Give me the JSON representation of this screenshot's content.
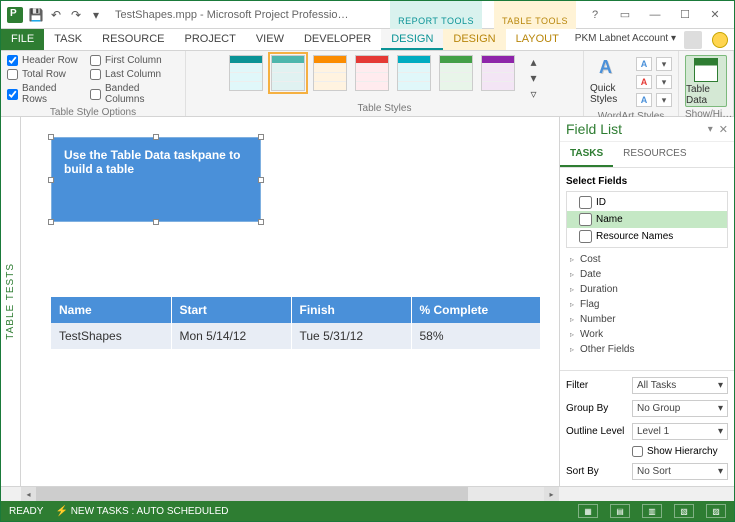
{
  "titlebar": {
    "title": "TestShapes.mpp - Microsoft Project Professio…",
    "context_groups": [
      "REPORT TOOLS",
      "TABLE TOOLS"
    ],
    "account": "PKM Labnet Account"
  },
  "ribbon_tabs": {
    "file": "FILE",
    "items": [
      "TASK",
      "RESOURCE",
      "PROJECT",
      "VIEW",
      "DEVELOPER"
    ],
    "ctx": [
      "DESIGN",
      "DESIGN",
      "LAYOUT"
    ]
  },
  "ribbon": {
    "style_options": {
      "header_row": "Header Row",
      "total_row": "Total Row",
      "banded_rows": "Banded Rows",
      "first_column": "First Column",
      "last_column": "Last Column",
      "banded_columns": "Banded Columns",
      "label": "Table Style Options"
    },
    "table_styles_label": "Table Styles",
    "wordart_label": "WordArt Styles",
    "quick_styles": "Quick Styles",
    "show_hide": {
      "table_data": "Table Data",
      "label": "Show/Hi…"
    }
  },
  "sidebar_vertical": "TABLE TESTS",
  "callout_text": "Use the Table Data taskpane to build a table",
  "table": {
    "headers": [
      "Name",
      "Start",
      "Finish",
      "% Complete"
    ],
    "rows": [
      [
        "TestShapes",
        "Mon 5/14/12",
        "Tue 5/31/12",
        "58%"
      ]
    ]
  },
  "pane": {
    "title": "Field List",
    "tabs": [
      "TASKS",
      "RESOURCES"
    ],
    "select_fields_label": "Select Fields",
    "check_fields": [
      "ID",
      "Name",
      "Resource Names"
    ],
    "tree_fields": [
      "Cost",
      "Date",
      "Duration",
      "Flag",
      "Number",
      "Work",
      "Other Fields"
    ],
    "footer": {
      "filter_label": "Filter",
      "filter_value": "All Tasks",
      "group_label": "Group By",
      "group_value": "No Group",
      "outline_label": "Outline Level",
      "outline_value": "Level 1",
      "show_hierarchy": "Show Hierarchy",
      "sort_label": "Sort By",
      "sort_value": "No Sort"
    }
  },
  "status": {
    "ready": "READY",
    "new_tasks": "NEW TASKS : AUTO SCHEDULED"
  }
}
